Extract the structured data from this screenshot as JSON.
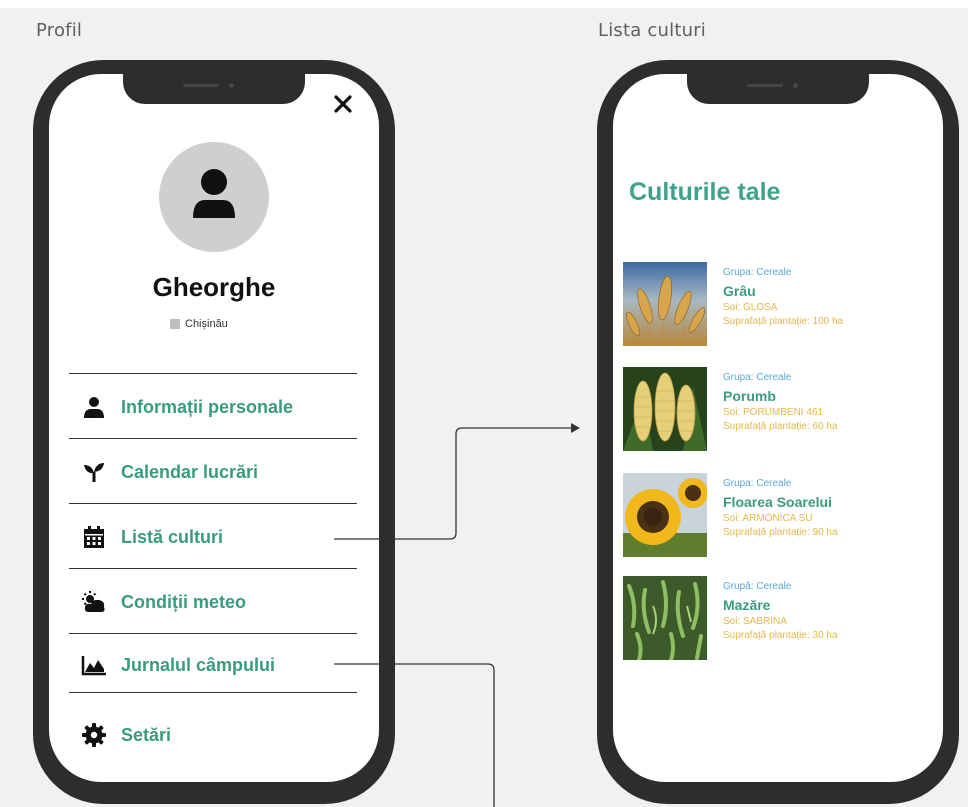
{
  "profile_frame": {
    "label": "Profil",
    "user": {
      "name": "Gheorghe",
      "location": "Chișinău"
    },
    "menu": [
      {
        "label": "Informații personale",
        "icon": "person-icon"
      },
      {
        "label": "Calendar lucrări",
        "icon": "seedling-icon"
      },
      {
        "label": "Listă culturi",
        "icon": "calendar-icon"
      },
      {
        "label": "Condiții meteo",
        "icon": "weather-icon"
      },
      {
        "label": "Jurnalul câmpului",
        "icon": "area-chart-icon"
      },
      {
        "label": "Setări",
        "icon": "gear-icon"
      }
    ]
  },
  "crops_frame": {
    "label": "Lista culturi",
    "title": "Culturile tale",
    "crops": [
      {
        "group": "Grupa: Cereale",
        "name": "Grâu",
        "soi": "Soi: GLOSA",
        "area": "Suprafață plantație: 100 ha",
        "image": "wheat-image"
      },
      {
        "group": "Grupa: Cereale",
        "name": "Porumb",
        "soi": "Soi: PORUMBENI 461",
        "area": "Suprafață plantație: 60 ha",
        "image": "corn-image"
      },
      {
        "group": "Grupa: Cereale",
        "name": "Floarea Soarelui",
        "soi": "Soi: ARMONICA SU",
        "area": "Suprafață plantație: 90 ha",
        "image": "sunflower-image"
      },
      {
        "group": "Grupă: Cereale",
        "name": "Mazăre",
        "soi": "Soi: SABRINA",
        "area": "Suprafață plantație: 30 ha",
        "image": "pea-image"
      }
    ]
  },
  "colors": {
    "accent": "#3a9b80",
    "group_text": "#5aa8d6",
    "detail_text": "#e4b84b",
    "phone_body": "#2d2d2d"
  }
}
